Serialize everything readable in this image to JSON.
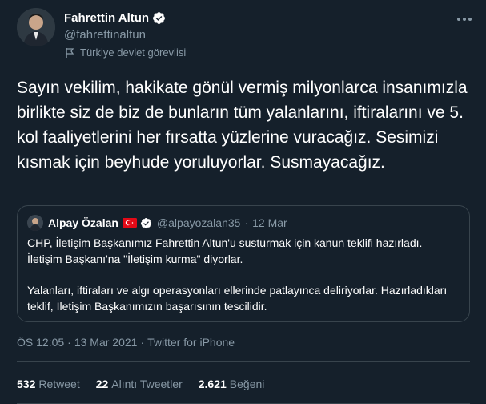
{
  "author": {
    "name": "Fahrettin Altun",
    "handle": "@fahrettinaltun",
    "label": "Türkiye devlet görevlisi"
  },
  "tweet": {
    "text": "Sayın vekilim, hakikate gönül vermiş milyonlarca insanımızla birlikte siz de biz de bunların tüm yalanlarını, iftiralarını ve 5. kol faaliyetlerini her fırsatta yüzlerine vuracağız. Sesimizi kısmak için beyhude yoruluyorlar. Susmayacağız."
  },
  "quote": {
    "name": "Alpay Özalan",
    "handle": "@alpayozalan35",
    "separator": "·",
    "date": "12 Mar",
    "paragraph1": "CHP, İletişim Başkanımız Fahrettin Altun'u susturmak için kanun teklifi hazırladı. İletişim Başkanı'na \"İletişim kurma\" diyorlar.",
    "paragraph2": "Yalanları, iftiraları ve algı operasyonları ellerinde patlayınca deliriyorlar. Hazırladıkları teklif, İletişim Başkanımızın başarısının tescilidir."
  },
  "meta": {
    "time": "ÖS 12:05",
    "separator1": "·",
    "date": "13 Mar 2021",
    "separator2": "·",
    "source": "Twitter for iPhone"
  },
  "stats": {
    "retweets": "532",
    "retweets_label": "Retweet",
    "quotes": "22",
    "quotes_label": "Alıntı Tweetler",
    "likes": "2.621",
    "likes_label": "Beğeni"
  },
  "colors": {
    "background": "#15202b",
    "secondary_text": "#8899a6",
    "verified": "#1da1f2",
    "border": "#38444d"
  }
}
